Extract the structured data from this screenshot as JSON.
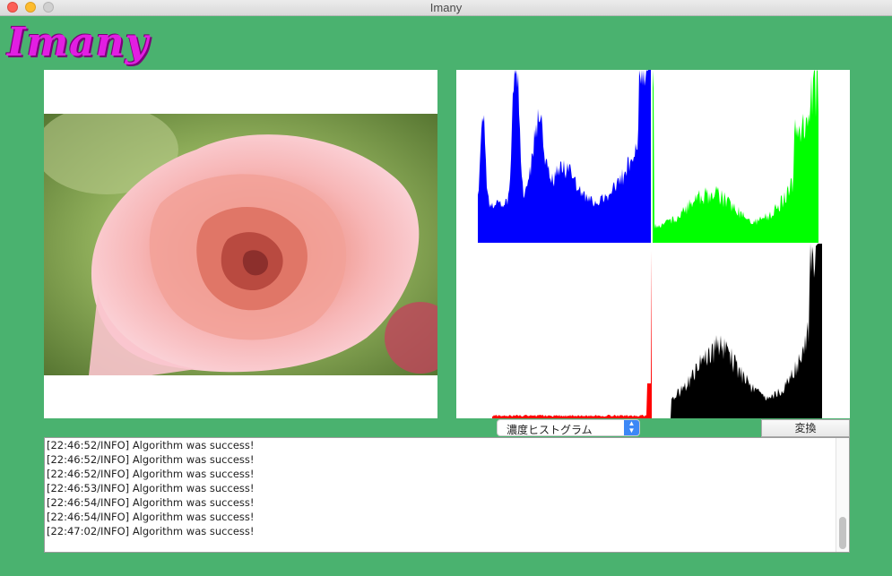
{
  "window": {
    "title": "Imany"
  },
  "logo": {
    "text": "Imany"
  },
  "controls": {
    "mode_select_value": "濃度ヒストグラム",
    "convert_label": "変換"
  },
  "log": {
    "lines": [
      "[22:46:52/INFO] Algorithm was success!",
      "[22:46:52/INFO] Algorithm was success!",
      "[22:46:52/INFO] Algorithm was success!",
      "[22:46:53/INFO] Algorithm was success!",
      "[22:46:54/INFO] Algorithm was success!",
      "[22:46:54/INFO] Algorithm was success!",
      "[22:47:02/INFO] Algorithm was success!"
    ]
  },
  "colors": {
    "background": "#4ab26f",
    "logo": "#e21ee2",
    "hist_blue": "#0000ff",
    "hist_green": "#00ff00",
    "hist_red": "#ff0000",
    "hist_gray": "#000000"
  },
  "icons": {
    "close": "close-traffic-light-icon",
    "minimize": "minimize-traffic-light-icon",
    "zoom": "zoom-traffic-light-icon",
    "select_arrows": "chevron-updown-icon"
  }
}
